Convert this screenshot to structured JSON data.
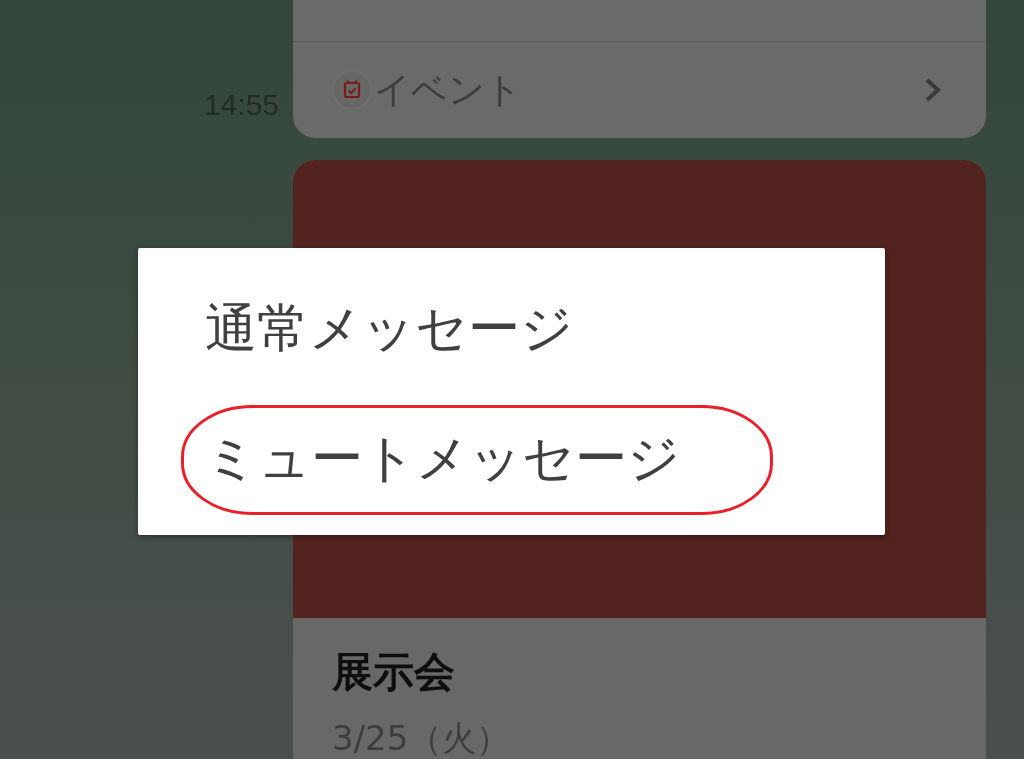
{
  "chat": {
    "event_card": {
      "label": "イベント"
    },
    "timestamp": "14:55",
    "event_post": {
      "title": "展示会",
      "date": "3/25（火）"
    }
  },
  "menu": {
    "items": [
      {
        "label": "通常メッセージ",
        "highlighted": false
      },
      {
        "label": "ミュートメッセージ",
        "highlighted": true
      }
    ]
  }
}
